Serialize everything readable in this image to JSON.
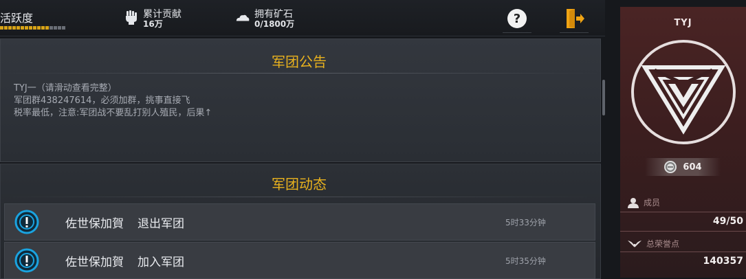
{
  "topbar": {
    "activity_label": "活跃度",
    "activity_level": 0.75,
    "contribution": {
      "label": "累计贡献",
      "value": "16万",
      "icon": "fist-icon"
    },
    "ore": {
      "label": "拥有矿石",
      "value": "0/1800万",
      "icon": "ore-cloud-icon"
    },
    "help_icon": "help-icon",
    "exit_icon": "exit-door-icon"
  },
  "notice": {
    "title": "军团公告",
    "text": "TYJ一（请滑动查看完整）\n军团群438247614，必须加群，挑事直接飞\n税率最低，注意:军团战不要乱打别人殖民，后果↑"
  },
  "dynamics": {
    "title": "军团动态",
    "items": [
      {
        "name": "佐世保加賀",
        "action": "退出军团",
        "time": "5时33分钟"
      },
      {
        "name": "佐世保加賀",
        "action": "加入军团",
        "time": "5时35分钟"
      }
    ]
  },
  "side": {
    "name": "TYJ",
    "points": "604",
    "members_label": "成员",
    "members_value": "49/50",
    "honor_label": "总荣誉点",
    "honor_value": "140357"
  },
  "colors": {
    "accent": "#e9b21e",
    "info_icon": "#1aa3e0",
    "side_bg": "#3c1e1f"
  }
}
